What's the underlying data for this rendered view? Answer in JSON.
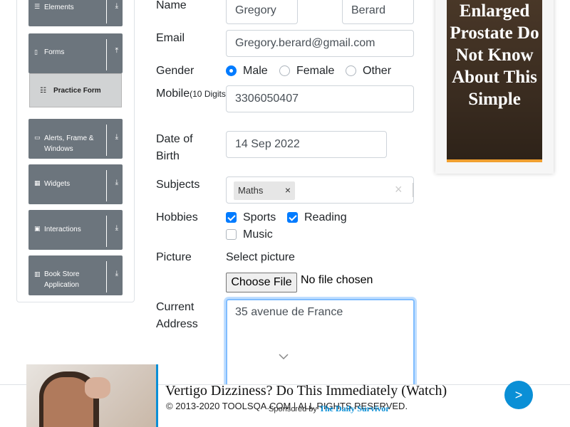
{
  "sidebar": {
    "groups": [
      {
        "label": "Elements",
        "icon": "list-icon",
        "arrow": "⤓"
      },
      {
        "label": "Forms",
        "icon": "form-icon",
        "arrow": "⤒"
      },
      {
        "label": "Alerts, Frame & Windows",
        "icon": "window-icon",
        "arrow": "⤓"
      },
      {
        "label": "Widgets",
        "icon": "widgets-icon",
        "arrow": "⤓"
      },
      {
        "label": "Interactions",
        "icon": "interactions-icon",
        "arrow": "⤓"
      },
      {
        "label": "Book Store Application",
        "icon": "chart-icon",
        "arrow": "⤓"
      }
    ],
    "active_item": "Practice Form"
  },
  "form": {
    "name_label": "Name",
    "first_name": "Gregory",
    "last_name": "Berard",
    "email_label": "Email",
    "email": "Gregory.berard@gmail.com",
    "gender_label": "Gender",
    "gender_options": [
      "Male",
      "Female",
      "Other"
    ],
    "gender_selected": "Male",
    "mobile_label": "Mobile",
    "mobile_hint": "(10 Digits)",
    "mobile": "3306050407",
    "dob_label_1": "Date of",
    "dob_label_2": "Birth",
    "dob": "14 Sep 2022",
    "subjects_label": "Subjects",
    "subjects": [
      "Maths"
    ],
    "hobbies_label": "Hobbies",
    "hobbies": [
      {
        "label": "Sports",
        "checked": true
      },
      {
        "label": "Reading",
        "checked": true
      },
      {
        "label": "Music",
        "checked": false
      }
    ],
    "picture_label": "Picture",
    "select_picture": "Select picture",
    "choose_file": "Choose File",
    "no_file": "No file chosen",
    "address_label_1": "Current",
    "address_label_2": "Address",
    "address": "35 avenue de France"
  },
  "right_ad": {
    "text": "Enlarged Prostate Do Not Know About This Simple",
    "accent": "#f0a030"
  },
  "footer": {
    "copyright": "© 2013-2020 TOOLSQA.COM | ALL RIGHTS RESERVED."
  },
  "bottom_ad": {
    "title": "Vertigo Dizziness? Do This Immediately (Watch)",
    "sponsored_prefix": "Sponsored by",
    "sponsor": "The Daily Survivor",
    "next": ">",
    "accent": "#0a8fd6"
  },
  "colors": {
    "primary": "#007bff",
    "sidebar_group": "#6c757d",
    "focus_border": "#80bdff"
  }
}
